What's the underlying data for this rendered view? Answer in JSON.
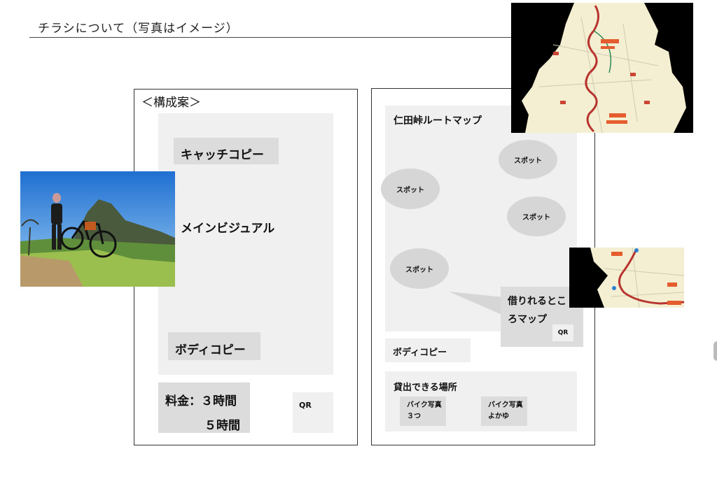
{
  "page": {
    "title": "チラシについて（写真はイメージ）"
  },
  "front": {
    "section_label": "＜構成案＞",
    "catch_copy": "キャッチコピー",
    "main_visual": "メインビジュアル",
    "body_copy": "ボディコピー",
    "price_line1": "料金：３時間",
    "price_line2": "５時間",
    "qr": "QR"
  },
  "back": {
    "map_title": "仁田峠ルートマップ",
    "spots": [
      "スポット",
      "スポット",
      "スポット",
      "スポット"
    ],
    "rental_spot_line1": "借りれるとこ",
    "rental_spot_line2": "ろマップ",
    "qr": "QR",
    "body_copy": "ボディコピー",
    "rental_places_title": "貸出できる場所",
    "bike_photo_1_line1": "バイク写真",
    "bike_photo_1_line2": "３つ",
    "bike_photo_2_line1": "バイク写真",
    "bike_photo_2_line2": "よかゆ"
  },
  "colors": {
    "placeholder_gray": "#f0f0f0",
    "label_gray": "#dcdcdc",
    "spot_gray": "#d6d6d6",
    "route_red": "#b8342f"
  }
}
